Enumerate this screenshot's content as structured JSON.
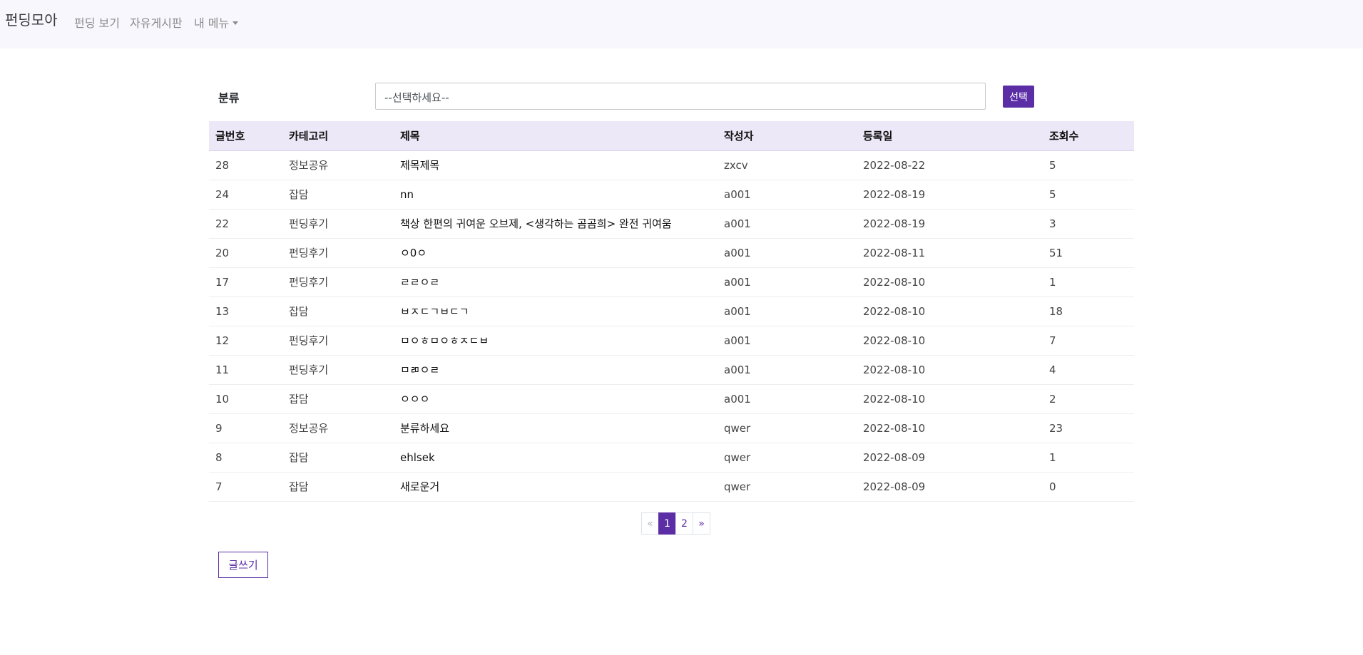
{
  "navbar": {
    "brand": "펀딩모아",
    "links": [
      "펀딩 보기",
      "자유게시판",
      "내 메뉴"
    ]
  },
  "filter": {
    "label": "분류",
    "selected": "--선택하세요--",
    "button": "선택"
  },
  "table": {
    "headers": [
      "글번호",
      "카테고리",
      "제목",
      "작성자",
      "등록일",
      "조회수"
    ],
    "rows": [
      [
        "28",
        "정보공유",
        "제목제목",
        "zxcv",
        "2022-08-22",
        "5"
      ],
      [
        "24",
        "잡담",
        "nn",
        "a001",
        "2022-08-19",
        "5"
      ],
      [
        "22",
        "펀딩후기",
        "책상 한편의 귀여운 오브제, <생각하는 곰곰희> 완전 귀여움",
        "a001",
        "2022-08-19",
        "3"
      ],
      [
        "20",
        "펀딩후기",
        "ㅇ0ㅇ",
        "a001",
        "2022-08-11",
        "51"
      ],
      [
        "17",
        "펀딩후기",
        "ㄹㄹㅇㄹ",
        "a001",
        "2022-08-10",
        "1"
      ],
      [
        "13",
        "잡담",
        "ㅂㅈㄷㄱㅂㄷㄱ",
        "a001",
        "2022-08-10",
        "18"
      ],
      [
        "12",
        "펀딩후기",
        "ㅁㅇㅎㅁㅇㅎㅈㄷㅂ",
        "a001",
        "2022-08-10",
        "7"
      ],
      [
        "11",
        "펀딩후기",
        "ㅁㄻㅇㄹ",
        "a001",
        "2022-08-10",
        "4"
      ],
      [
        "10",
        "잡담",
        "ㅇㅇㅇ",
        "a001",
        "2022-08-10",
        "2"
      ],
      [
        "9",
        "정보공유",
        "분류하세요",
        "qwer",
        "2022-08-10",
        "23"
      ],
      [
        "8",
        "잡담",
        "ehlsek",
        "qwer",
        "2022-08-09",
        "1"
      ],
      [
        "7",
        "잡담",
        "새로운거",
        "qwer",
        "2022-08-09",
        "0"
      ]
    ]
  },
  "pagination": {
    "prev": "«",
    "pages": [
      "1",
      "2"
    ],
    "active": "1",
    "next": "»"
  },
  "write_button": "글쓰기",
  "colors": {
    "accent": "#5b2ea6",
    "navbar_bg": "#f8f7fd",
    "table_header_bg": "#ece8f7"
  }
}
